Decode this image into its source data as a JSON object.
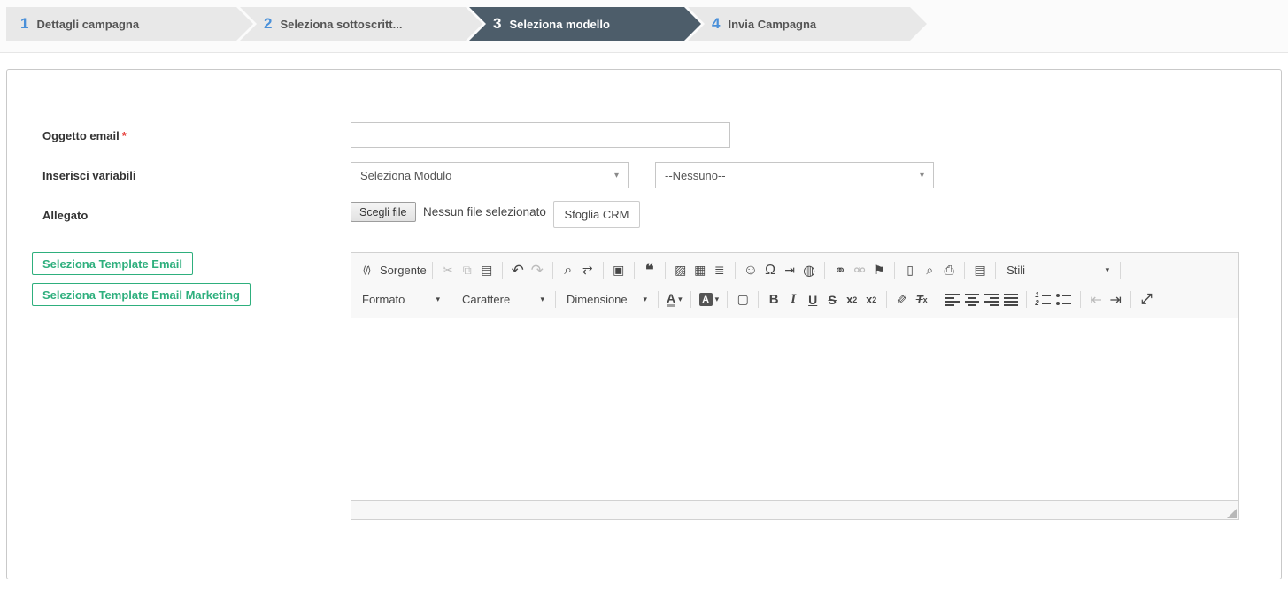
{
  "stepper": {
    "steps": [
      {
        "number": "1",
        "label": "Dettagli campagna",
        "state": "inactive"
      },
      {
        "number": "2",
        "label": "Seleziona sottoscritt...",
        "state": "inactive"
      },
      {
        "number": "3",
        "label": "Seleziona modello",
        "state": "active"
      },
      {
        "number": "4",
        "label": "Invia Campagna",
        "state": "inactive"
      }
    ]
  },
  "form": {
    "subject": {
      "label": "Oggetto email",
      "required_mark": "*",
      "value": ""
    },
    "variables": {
      "label": "Inserisci variabili",
      "module_select_value": "Seleziona Modulo",
      "field_select_value": "--Nessuno--"
    },
    "attachment": {
      "label": "Allegato",
      "choose_file_button": "Scegli file",
      "status_text": "Nessun file selezionato",
      "browse_crm_button": "Sfoglia CRM"
    },
    "template_buttons": {
      "email": "Seleziona Template Email",
      "marketing": "Seleziona Template Email Marketing"
    }
  },
  "editor": {
    "source_label": "Sorgente",
    "combos": {
      "format": "Formato",
      "font": "Carattere",
      "size": "Dimensione",
      "styles": "Stili"
    },
    "icons": {
      "source": "⟨/⟩",
      "cut": "✂",
      "copy": "⧉",
      "paste": "▤",
      "undo": "↶",
      "redo": "↷",
      "find": "⌕",
      "replace": "⇄",
      "select_all": "▣",
      "blockquote": "❝",
      "image": "▨",
      "table": "▦",
      "horizontal_rule": "≣",
      "smiley": "☺",
      "special_char": "Ω",
      "page_break": "⇥",
      "iframe": "◍",
      "link": "⚭",
      "unlink": "⚮",
      "anchor": "⚑",
      "new_page": "▯",
      "preview": "⌕",
      "print": "⎙",
      "templates": "▤",
      "caret": "▾",
      "text_color": "A",
      "bg_color": "A",
      "div_container": "▢",
      "bold": "B",
      "italic": "I",
      "underline": "U",
      "strike": "S",
      "sub_x": "x",
      "sub_2": "2",
      "sup_x": "x",
      "sup_2": "2",
      "copy_formatting": "✐",
      "remove_format_t": "T",
      "remove_format_x": "x",
      "outdent": "⇤",
      "indent": "⇥",
      "maximize": "⤢"
    }
  },
  "colors": {
    "step_active_bg": "#4d5d6a",
    "step_inactive_bg": "#e8e8e8",
    "step_number_blue": "#4a90d9",
    "green_accent": "#2eaf7d",
    "required_red": "#e53935",
    "panel_border": "#c9c9c9",
    "toolbar_bg": "#f8f8f8"
  }
}
